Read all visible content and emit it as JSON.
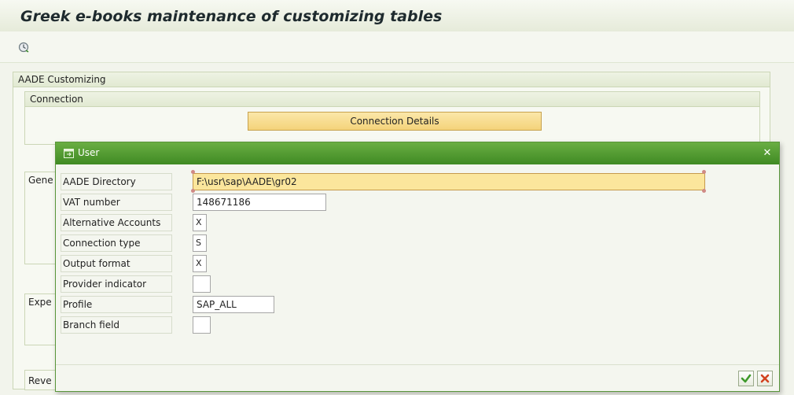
{
  "app": {
    "title": "Greek e-books maintenance of customizing tables"
  },
  "toolbar": {
    "execute_icon": "execute-clock-icon"
  },
  "groups": {
    "outer_label": "AADE Customizing",
    "connection_label": "Connection",
    "connection_button_label": "Connection Details",
    "partial_labels": [
      "Gene",
      "Expe",
      "Reve"
    ]
  },
  "dialog": {
    "title": "User",
    "fields": [
      {
        "label": "AADE Directory",
        "value": "F:\\usr\\sap\\AADE\\gr02"
      },
      {
        "label": "VAT number",
        "value": "148671186"
      },
      {
        "label": "Alternative Accounts",
        "value": "X"
      },
      {
        "label": "Connection type",
        "value": "S"
      },
      {
        "label": "Output format",
        "value": "X"
      },
      {
        "label": "Provider indicator",
        "value": ""
      },
      {
        "label": "Profile",
        "value": "SAP_ALL"
      },
      {
        "label": "Branch field",
        "value": ""
      }
    ]
  },
  "colors": {
    "dialog_title_bar": "#4f9a2f",
    "highlight_field": "#fbe69c",
    "button_yellow": "#f4d37a"
  }
}
